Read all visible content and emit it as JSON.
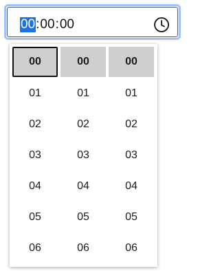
{
  "field": {
    "hours": "00",
    "minutes": "00",
    "seconds": "00",
    "separator": ":",
    "selected_segment": "hours",
    "button_icon": "clock-icon"
  },
  "picker": {
    "hours": [
      "00",
      "01",
      "02",
      "03",
      "04",
      "05",
      "06"
    ],
    "minutes": [
      "00",
      "01",
      "02",
      "03",
      "04",
      "05",
      "06"
    ],
    "seconds": [
      "00",
      "01",
      "02",
      "03",
      "04",
      "05",
      "06"
    ],
    "selected_index": 0
  },
  "colors": {
    "focus_ring": "#9fc4f5",
    "selection_highlight": "#1a73e8",
    "selected_option_bg": "#cfcfcf"
  }
}
